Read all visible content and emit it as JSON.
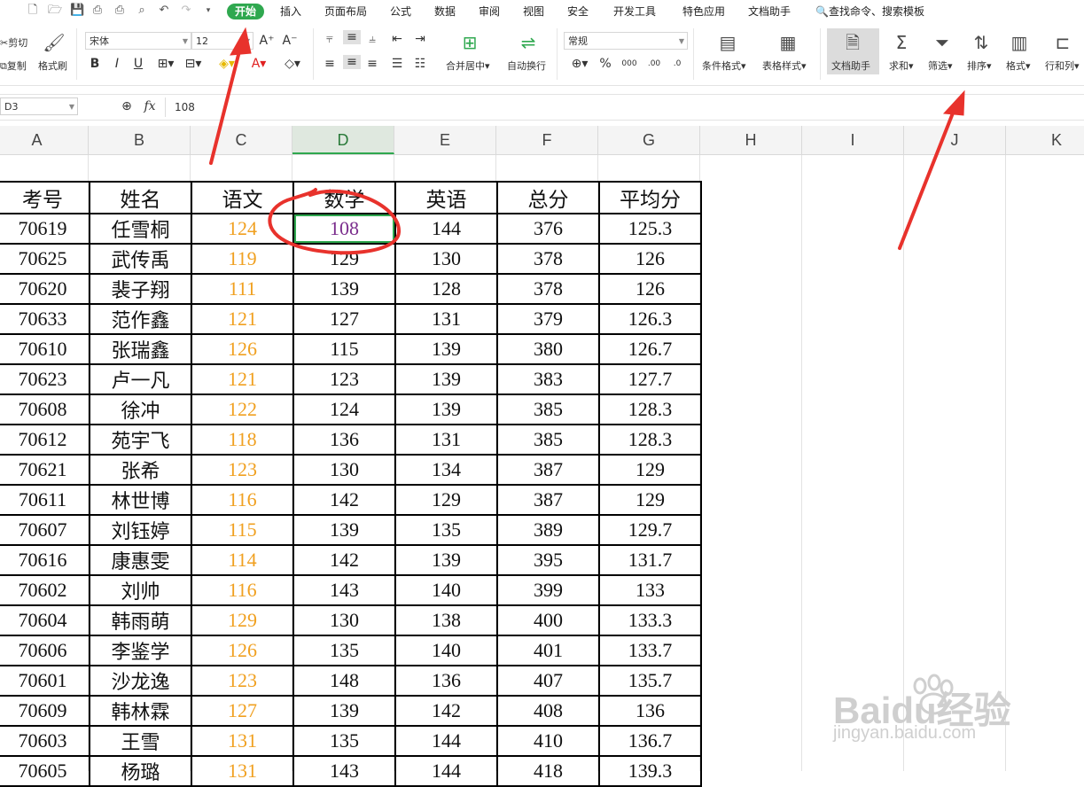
{
  "menu": {
    "tabs": [
      "开始",
      "插入",
      "页面布局",
      "公式",
      "数据",
      "审阅",
      "视图",
      "安全",
      "开发工具",
      "特色应用",
      "文档助手"
    ],
    "active_tab": "开始",
    "search_placeholder": "查找命令、搜索模板"
  },
  "ribbon": {
    "cut": "剪切",
    "copy": "复制",
    "format_painter": "格式刷",
    "font_name": "宋体",
    "font_size": "12",
    "merge_center": "合并居中",
    "wrap_text": "自动换行",
    "number_format": "常规",
    "conditional_format": "条件格式",
    "table_style": "表格样式",
    "doc_assistant": "文档助手",
    "sum": "求和",
    "filter": "筛选",
    "sort": "排序",
    "format": "格式",
    "rows_cols": "行和列",
    "bold": "B",
    "italic": "I",
    "underline": "U",
    "font_grow": "A⁺",
    "font_shrink": "A⁻",
    "currency": "¥",
    "percent": "%"
  },
  "formula_bar": {
    "cell_ref": "D3",
    "fx": "fx",
    "value": "108"
  },
  "columns": [
    "A",
    "B",
    "C",
    "D",
    "E",
    "F",
    "G",
    "H",
    "I",
    "J",
    "K"
  ],
  "selected_column": "D",
  "table": {
    "headers": [
      "考号",
      "姓名",
      "语文",
      "数学",
      "英语",
      "总分",
      "平均分"
    ],
    "rows": [
      [
        "70619",
        "任雪桐",
        "124",
        "108",
        "144",
        "376",
        "125.3"
      ],
      [
        "70625",
        "武传禹",
        "119",
        "129",
        "130",
        "378",
        "126"
      ],
      [
        "70620",
        "裴子翔",
        "111",
        "139",
        "128",
        "378",
        "126"
      ],
      [
        "70633",
        "范作鑫",
        "121",
        "127",
        "131",
        "379",
        "126.3"
      ],
      [
        "70610",
        "张瑞鑫",
        "126",
        "115",
        "139",
        "380",
        "126.7"
      ],
      [
        "70623",
        "卢一凡",
        "121",
        "123",
        "139",
        "383",
        "127.7"
      ],
      [
        "70608",
        "徐冲",
        "122",
        "124",
        "139",
        "385",
        "128.3"
      ],
      [
        "70612",
        "苑宇飞",
        "118",
        "136",
        "131",
        "385",
        "128.3"
      ],
      [
        "70621",
        "张希",
        "123",
        "130",
        "134",
        "387",
        "129"
      ],
      [
        "70611",
        "林世博",
        "116",
        "142",
        "129",
        "387",
        "129"
      ],
      [
        "70607",
        "刘钰婷",
        "115",
        "139",
        "135",
        "389",
        "129.7"
      ],
      [
        "70616",
        "康惠雯",
        "114",
        "142",
        "139",
        "395",
        "131.7"
      ],
      [
        "70602",
        "刘帅",
        "116",
        "143",
        "140",
        "399",
        "133"
      ],
      [
        "70604",
        "韩雨萌",
        "129",
        "130",
        "138",
        "400",
        "133.3"
      ],
      [
        "70606",
        "李鉴学",
        "126",
        "135",
        "140",
        "401",
        "133.7"
      ],
      [
        "70601",
        "沙龙逸",
        "123",
        "148",
        "136",
        "407",
        "135.7"
      ],
      [
        "70609",
        "韩林霖",
        "127",
        "139",
        "142",
        "408",
        "136"
      ],
      [
        "70603",
        "王雪",
        "131",
        "135",
        "144",
        "410",
        "136.7"
      ],
      [
        "70605",
        "杨璐",
        "131",
        "143",
        "144",
        "418",
        "139.3"
      ]
    ]
  },
  "watermark": {
    "brand": "Baidu经验",
    "url": "jingyan.baidu.com"
  },
  "colors": {
    "accent": "#2fa84f",
    "annotation": "#e8322c",
    "yuwen_text": "#f0a020",
    "selected_text": "#7a2c8c"
  }
}
